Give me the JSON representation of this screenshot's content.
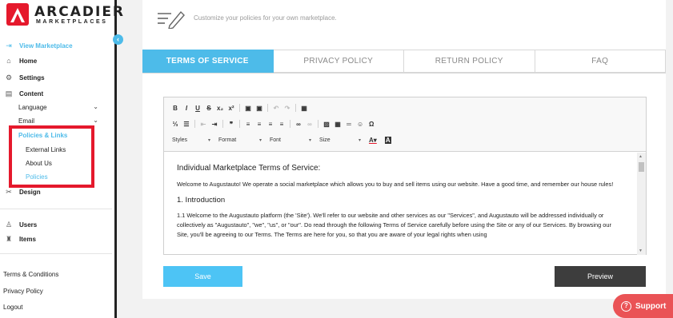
{
  "brand": {
    "name": "ARCADIER",
    "sub": "MARKETPLACES",
    "color": "#e5192c"
  },
  "sidebar": {
    "collapse_icon": "chevron-left-icon",
    "items": [
      {
        "label": "View Marketplace",
        "icon": "enter-icon",
        "active": true
      },
      {
        "label": "Home",
        "icon": "home-icon"
      },
      {
        "label": "Settings",
        "icon": "gear-icon"
      },
      {
        "label": "Content",
        "icon": "content-icon"
      }
    ],
    "content_sub": [
      {
        "label": "Language"
      },
      {
        "label": "Email"
      }
    ],
    "policies_header": "Policies & Links",
    "policies_sub": [
      {
        "label": "External Links"
      },
      {
        "label": "About Us"
      },
      {
        "label": "Policies",
        "active": true
      }
    ],
    "design": "Design",
    "users": "Users",
    "items_label": "Items",
    "footer": [
      "Terms & Conditions",
      "Privacy Policy",
      "Logout"
    ]
  },
  "main": {
    "hint": "Customize your policies for your own marketplace.",
    "tabs": [
      {
        "label": "TERMS OF SERVICE",
        "active": true
      },
      {
        "label": "PRIVACY POLICY"
      },
      {
        "label": "RETURN POLICY"
      },
      {
        "label": "FAQ"
      }
    ],
    "toolbar": {
      "styles": "Styles",
      "format": "Format",
      "font": "Font",
      "size": "Size"
    },
    "content": {
      "title": "Individual Marketplace Terms of Service:",
      "p1": "Welcome to Augustauto! We operate a social marketplace which allows you to buy and sell items using our website. Have a good time, and remember our house rules!",
      "h1": "1. Introduction",
      "p2": "1.1 Welcome to the Augustauto platform (the 'Site'). We'll refer to our website and other services as our \"Services\", and Augustauto will be addressed individually or collectively as \"Augustauto\", \"we\", \"us\", or \"our\". Do read through the following Terms of Service carefully before using the Site or any of our Services. By browsing our Site, you'll be agreeing to our Terms. The Terms are here for you, so that you are aware of your legal rights when using"
    },
    "save": "Save",
    "preview": "Preview"
  },
  "support": "Support",
  "colors": {
    "accent": "#4dbbe9",
    "highlight": "#e5192c",
    "dark": "#3d3d3d",
    "support": "#ea5356"
  }
}
